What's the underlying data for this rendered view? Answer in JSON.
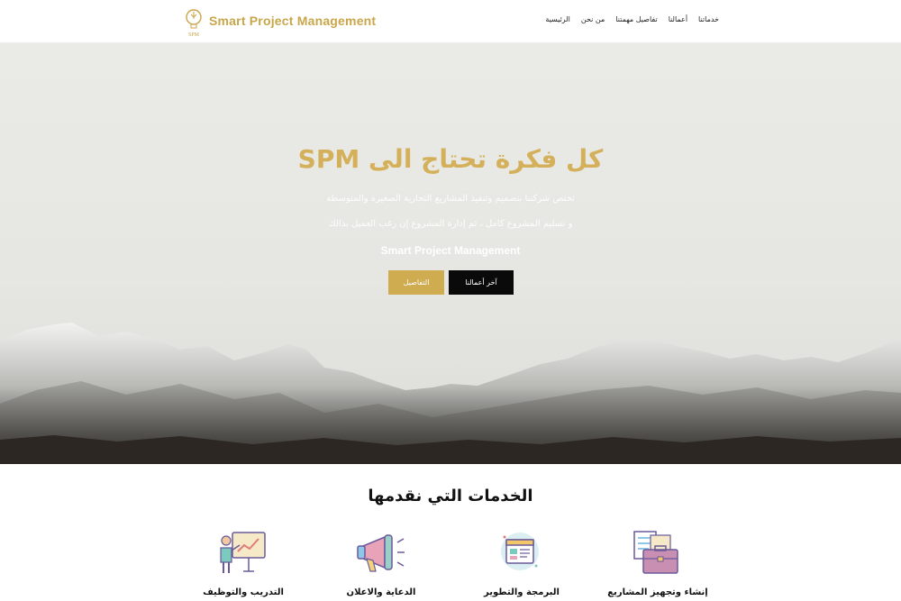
{
  "header": {
    "brand": "Smart Project Management",
    "logo_text": "SPM",
    "nav": [
      "الرئيسية",
      "من نحن",
      "تفاصيل مهمتنا",
      "أعمالنا",
      "خدماتنا"
    ]
  },
  "hero": {
    "title": "كل فكرة تحتاج الى SPM",
    "line1": "تختص شركتنا بتصميم وتنفيذ المشاريع التجارية الصغيرة والمتوسطة",
    "line2": "و تسليم المشروع كامل ، ثم إدارة المشروع إن رغب العميل بذالك",
    "brand": "Smart Project Management",
    "btn_details": "التفاصيل",
    "btn_latest": "آخر أعمالنا"
  },
  "services": {
    "title": "الخدمات التي نقدمها",
    "items": [
      {
        "label": "التدريب والتوظيف",
        "icon": "training-presentation-icon"
      },
      {
        "label": "الدعاية والاعلان",
        "icon": "megaphone-icon"
      },
      {
        "label": "البرمجة والتطوير",
        "icon": "coding-window-icon"
      },
      {
        "label": "إنشاء وتجهيز المشاريع",
        "icon": "briefcase-documents-icon"
      }
    ]
  },
  "colors": {
    "accent": "#cfac50",
    "dark_button": "#0a0a0a"
  }
}
